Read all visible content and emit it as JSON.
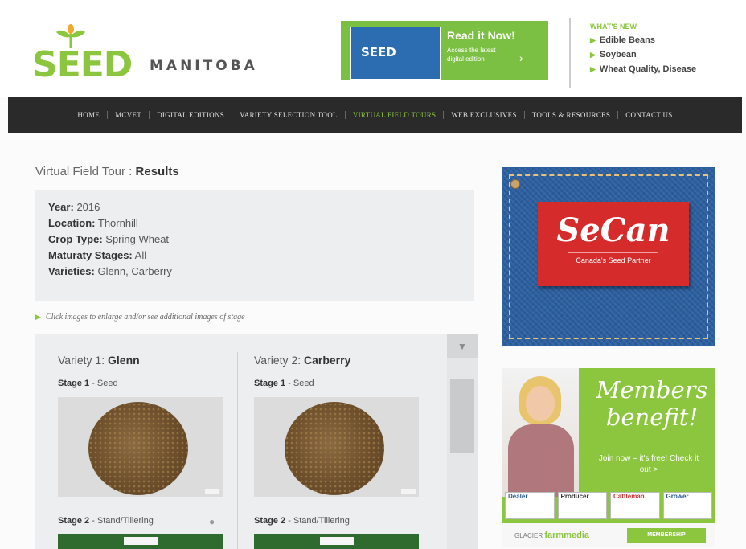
{
  "header": {
    "logo_seed": "SEED",
    "logo_manitoba": "MANITOBA",
    "promo": {
      "mag_label": "SEED",
      "title": "Read it Now!",
      "subtitle": "Access the latest digital edition"
    },
    "whats_new": {
      "title": "WHAT'S NEW",
      "items": [
        "Edible Beans",
        "Soybean",
        "Wheat Quality, Disease"
      ]
    }
  },
  "nav": {
    "items": [
      "HOME",
      "MCVET",
      "DIGITAL EDITIONS",
      "VARIETY SELECTION TOOL",
      "VIRTUAL FIELD TOURS",
      "WEB EXCLUSIVES",
      "TOOLS & RESOURCES",
      "CONTACT US"
    ],
    "active": "VIRTUAL FIELD TOURS",
    "accent": "#8cc63f"
  },
  "page": {
    "title_prefix": "Virtual Field Tour : ",
    "title_bold": "Results"
  },
  "info": {
    "year_label": "Year:",
    "year": "2016",
    "location_label": "Location:",
    "location": "Thornhill",
    "crop_label": "Crop Type:",
    "crop": "Spring Wheat",
    "maturity_label": "Maturaty Stages:",
    "maturity": "All",
    "varieties_label": "Varieties:",
    "varieties": "Glenn,  Carberry"
  },
  "hint": "Click images to enlarge and/or see additional images of stage",
  "results": {
    "variety1": {
      "prefix": "Variety 1: ",
      "name": "Glenn"
    },
    "variety2": {
      "prefix": "Variety 2: ",
      "name": "Carberry"
    },
    "stage1": {
      "label": "Stage 1",
      "name": " - Seed"
    },
    "stage2": {
      "label": "Stage 2",
      "name": " - Stand/Tillering"
    }
  },
  "ads": {
    "secan": {
      "name": "SeCan",
      "tagline": "Canada's Seed Partner"
    },
    "members": {
      "title_line1": "Members",
      "title_line2": "benefit!",
      "sub": "Join now – it's free! Check it out >",
      "mags": [
        "Dealer",
        "Producer",
        "Cattleman",
        "Grower"
      ],
      "brand_small": "GLACIER",
      "brand_big": "farmmedia",
      "button": "MEMBERSHIP"
    }
  }
}
